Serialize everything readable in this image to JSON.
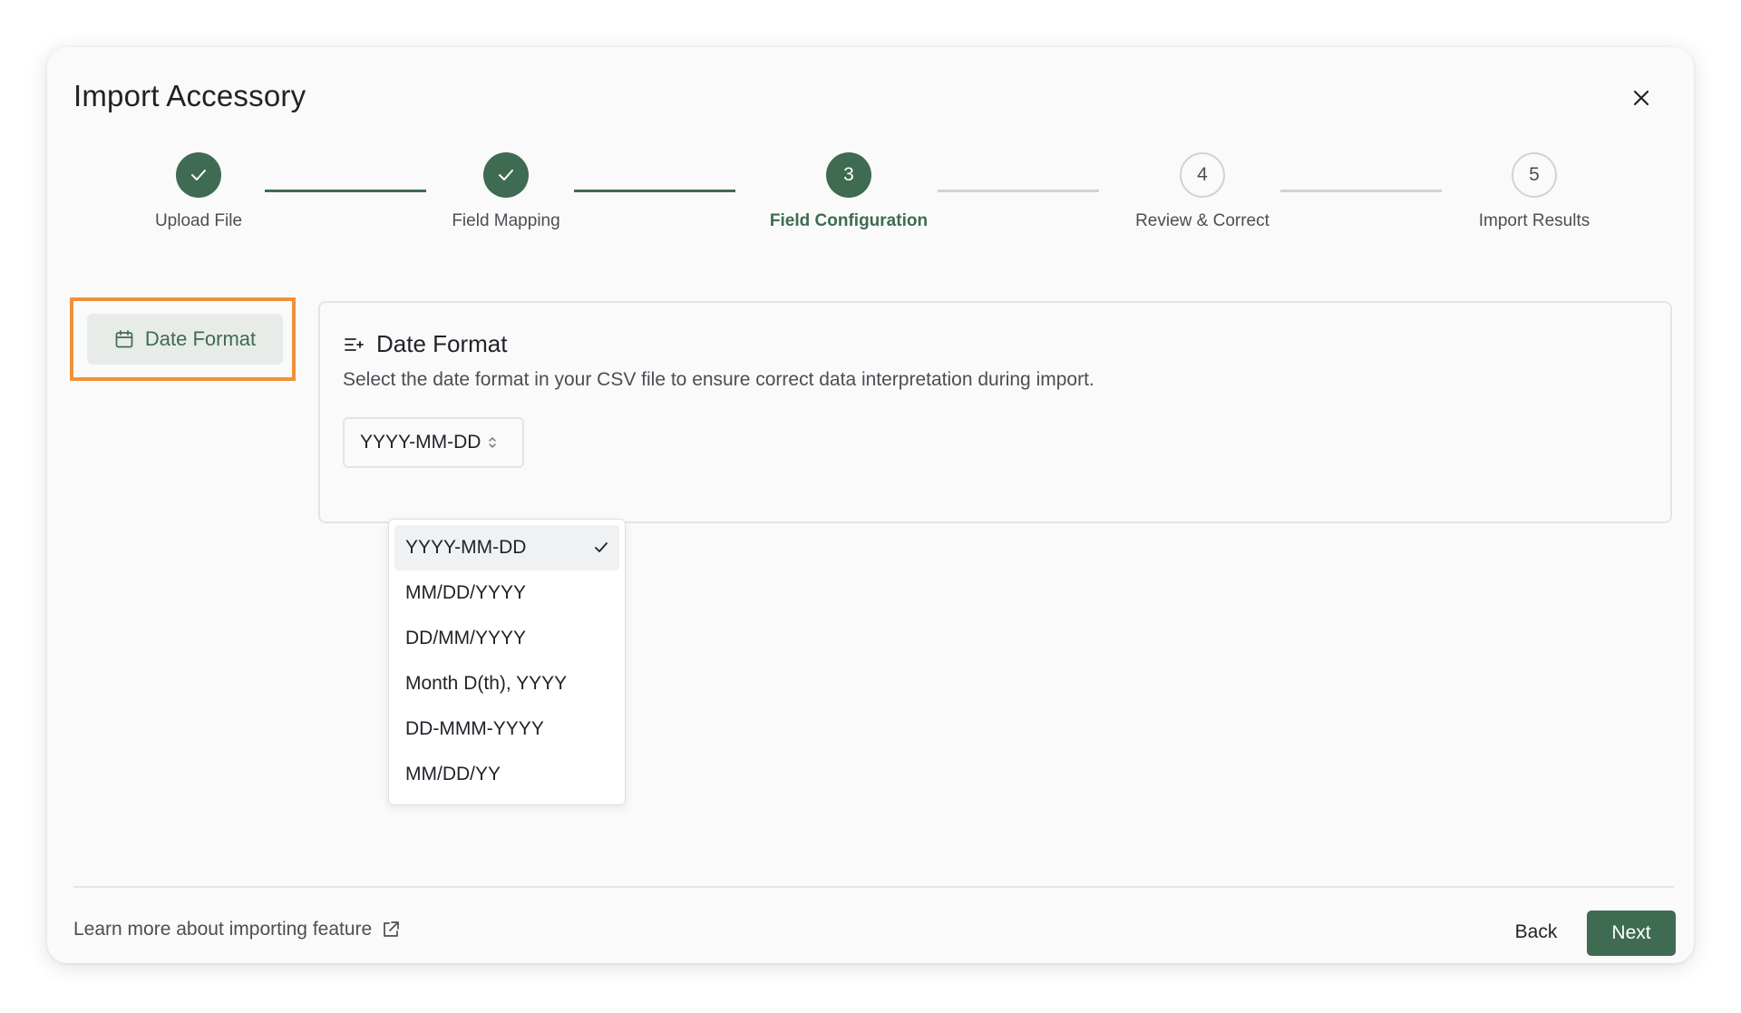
{
  "modal": {
    "title": "Import Accessory"
  },
  "stepper": {
    "steps": [
      {
        "number": "1",
        "label": "Upload File",
        "status": "done"
      },
      {
        "number": "2",
        "label": "Field Mapping",
        "status": "done"
      },
      {
        "number": "3",
        "label": "Field Configuration",
        "status": "active"
      },
      {
        "number": "4",
        "label": "Review & Correct",
        "status": "pending"
      },
      {
        "number": "5",
        "label": "Import Results",
        "status": "pending"
      }
    ]
  },
  "sidebar": {
    "tab_label": "Date Format"
  },
  "panel": {
    "title": "Date Format",
    "description": "Select the date format in your CSV file to ensure correct data interpretation during import.",
    "select_value": "YYYY-MM-DD"
  },
  "dropdown": {
    "options": [
      "YYYY-MM-DD",
      "MM/DD/YYYY",
      "DD/MM/YYYY",
      "Month D(th), YYYY",
      "DD-MMM-YYYY",
      "MM/DD/YY"
    ],
    "selected_index": 0
  },
  "footer": {
    "learn_more": "Learn more about importing feature",
    "back_label": "Back",
    "next_label": "Next"
  },
  "colors": {
    "accent": "#3f6b52",
    "highlight_outline": "#f0913a"
  },
  "icons": {
    "close": "close-icon",
    "check": "check-icon",
    "calendar": "calendar-icon",
    "list_add": "list-add-icon",
    "chevron": "chevron-updown-icon",
    "external": "external-link-icon"
  }
}
